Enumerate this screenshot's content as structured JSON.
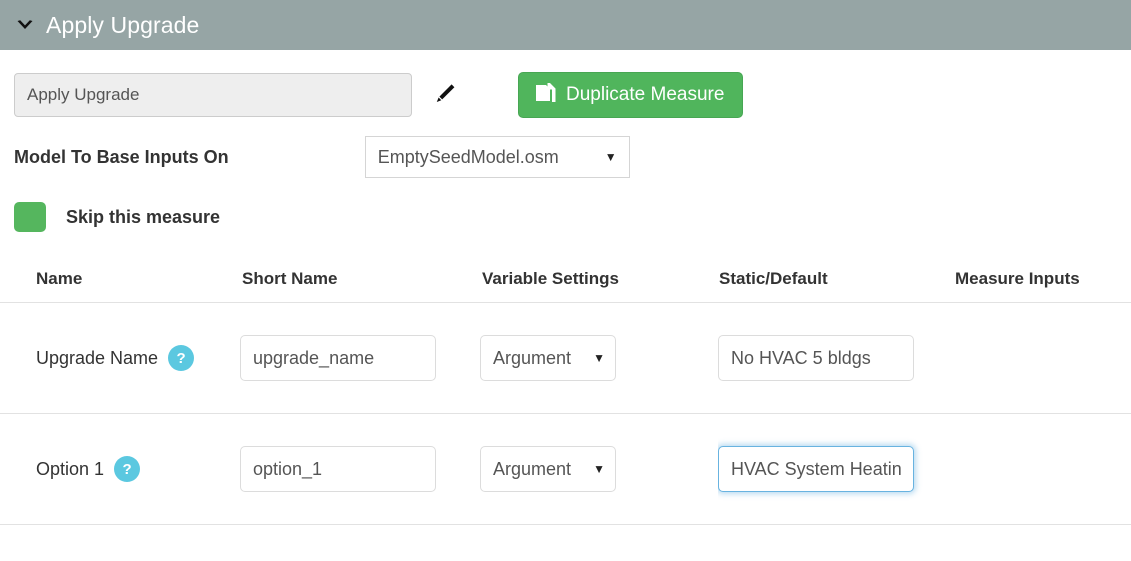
{
  "panel": {
    "title": "Apply Upgrade",
    "collapse_icon": "chevron-down-icon"
  },
  "toolbar": {
    "measure_name_value": "Apply Upgrade",
    "measure_name_placeholder": "Apply Upgrade",
    "edit_icon": "pencil-icon",
    "duplicate_label": "Duplicate Measure",
    "duplicate_icon": "duplicate-files-icon",
    "duplicate_color": "#50b55c"
  },
  "model": {
    "label": "Model To Base Inputs On",
    "selected": "EmptySeedModel.osm",
    "caret": "▼"
  },
  "skip": {
    "label": "Skip this measure",
    "toggle_color": "#55b65e",
    "checked": true
  },
  "table": {
    "headers": {
      "name": "Name",
      "short_name": "Short Name",
      "variable_settings": "Variable Settings",
      "static_default": "Static/Default",
      "measure_inputs": "Measure Inputs"
    },
    "rows": [
      {
        "name": "Upgrade Name",
        "help": "?",
        "short_name": "upgrade_name",
        "variable_setting": "Argument",
        "static_default": "No HVAC 5 bldgs ",
        "focused": false
      },
      {
        "name": "Option 1",
        "help": "?",
        "short_name": "option_1",
        "variable_setting": "Argument",
        "static_default": "HVAC System Heating",
        "focused": true
      }
    ]
  }
}
